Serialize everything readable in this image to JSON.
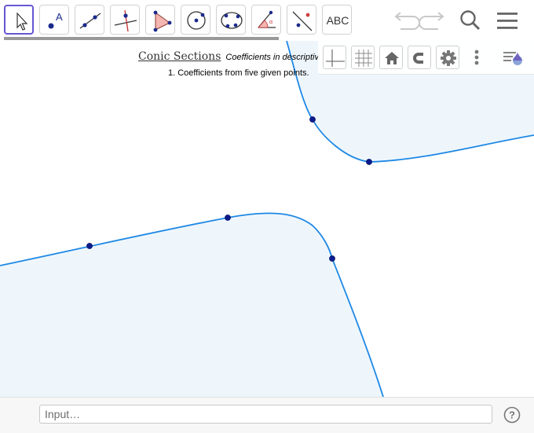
{
  "toolbar": {
    "text_tool_label": "ABC",
    "point_tool_label": "A"
  },
  "graphics": {
    "title": "Conic Sections",
    "title_note": "Coefficients in descriptiv",
    "subtitle": "1. Coefficients from five given points."
  },
  "input_bar": {
    "placeholder": "Input…"
  },
  "help": {
    "symbol": "?"
  },
  "colors": {
    "accent": "#6557d2",
    "curve": "#1e88e5",
    "fill": "#eef6fc",
    "point": "#0d1a8c",
    "progress": "#999999"
  }
}
